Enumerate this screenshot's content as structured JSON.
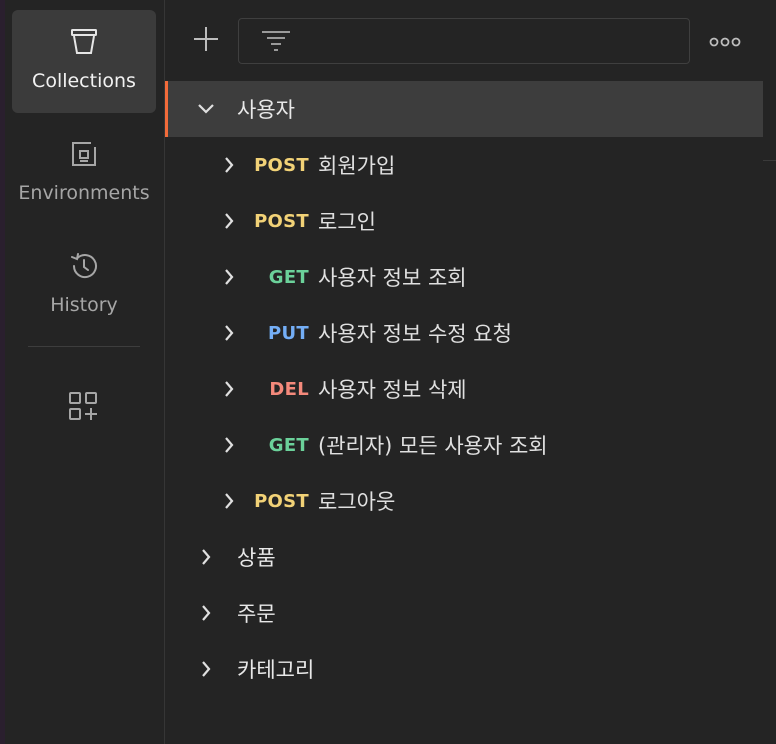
{
  "colors": {
    "post": "#f2d277",
    "get": "#6bd19a",
    "put": "#74aef6",
    "del": "#f4897b",
    "accent": "#f26b3a"
  },
  "sidebar": {
    "items": [
      {
        "label": "Collections",
        "icon": "collections-icon",
        "active": true
      },
      {
        "label": "Environments",
        "icon": "environments-icon",
        "active": false
      },
      {
        "label": "History",
        "icon": "history-icon",
        "active": false
      }
    ],
    "apps_icon": "add-apps-icon"
  },
  "toolbar": {
    "add_icon": "plus-icon",
    "filter_icon": "filter-icon",
    "filter_value": "",
    "more_icon": "more-icon"
  },
  "tree": {
    "folders": [
      {
        "name": "사용자",
        "expanded": true,
        "selected": true,
        "requests": [
          {
            "method": "POST",
            "name": "회원가입"
          },
          {
            "method": "POST",
            "name": "로그인"
          },
          {
            "method": "GET",
            "name": "사용자 정보 조회"
          },
          {
            "method": "PUT",
            "name": "사용자 정보 수정 요청"
          },
          {
            "method": "DEL",
            "name": "사용자 정보 삭제"
          },
          {
            "method": "GET",
            "name": "(관리자) 모든 사용자 조회"
          },
          {
            "method": "POST",
            "name": "로그아웃"
          }
        ]
      },
      {
        "name": "상품",
        "expanded": false,
        "selected": false
      },
      {
        "name": "주문",
        "expanded": false,
        "selected": false
      },
      {
        "name": "카테고리",
        "expanded": false,
        "selected": false
      }
    ]
  }
}
